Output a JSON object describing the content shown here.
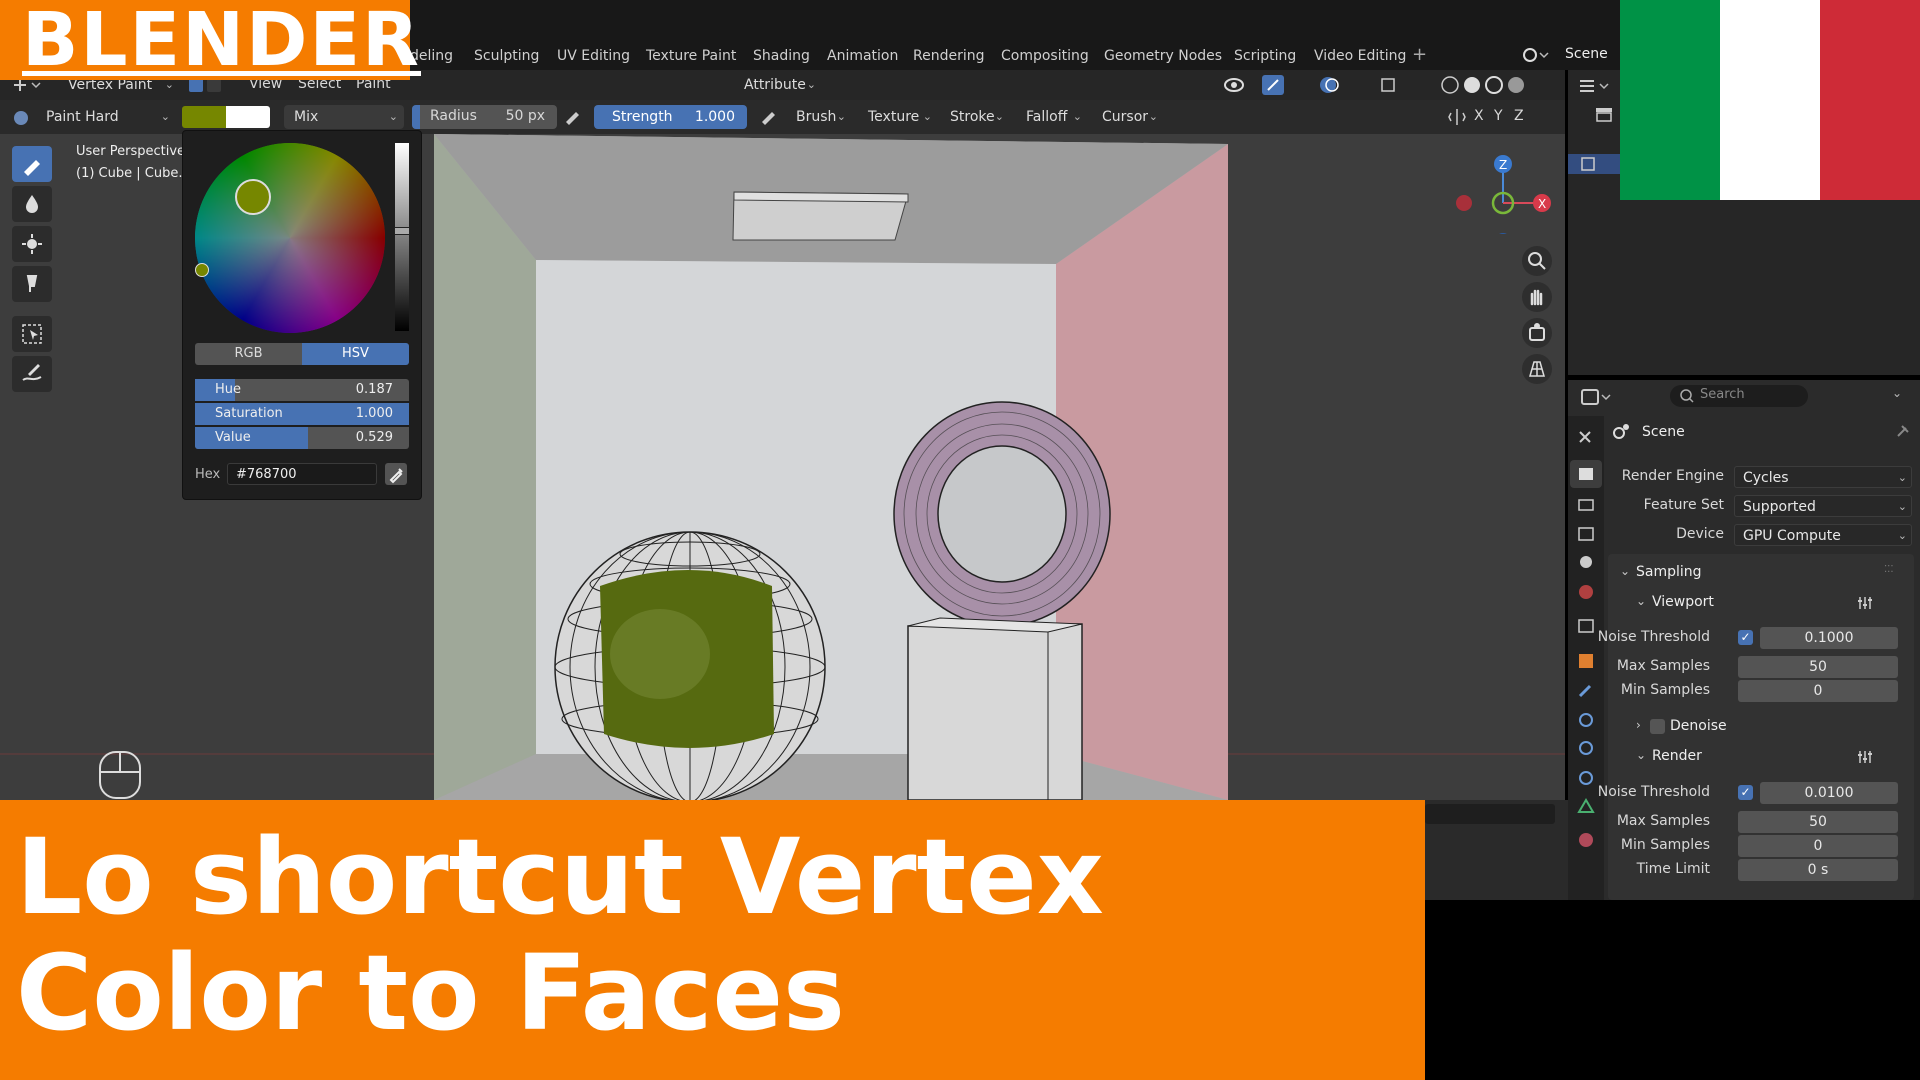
{
  "brand": {
    "text": "BLENDER"
  },
  "workspace_tabs": [
    "deling",
    "Sculpting",
    "UV Editing",
    "Texture Paint",
    "Shading",
    "Animation",
    "Rendering",
    "Compositing",
    "Geometry Nodes",
    "Scripting",
    "Video Editing"
  ],
  "scene_name": "Scene",
  "header": {
    "mode": "Vertex Paint",
    "menus": [
      "View",
      "Select",
      "Paint"
    ],
    "attribute": "Attribute"
  },
  "tool_settings": {
    "brush": "Paint Hard",
    "blend": "Mix",
    "radius_label": "Radius",
    "radius_value": "50 px",
    "strength_label": "Strength",
    "strength_value": "1.000",
    "menus": [
      "Brush",
      "Texture",
      "Stroke",
      "Falloff",
      "Cursor"
    ],
    "axes": [
      "X",
      "Y",
      "Z"
    ]
  },
  "viewport": {
    "info_line1": "User Perspective",
    "info_line2": "(1) Cube | Cube."
  },
  "color_picker": {
    "mode_rgb": "RGB",
    "mode_hsv": "HSV",
    "hue_label": "Hue",
    "hue_value": "0.187",
    "hue": 0.187,
    "sat_label": "Saturation",
    "sat_value": "1.000",
    "saturation": 1.0,
    "val_label": "Value",
    "val_value": "0.529",
    "value": 0.529,
    "hex_label": "Hex",
    "hex_value": "#768700"
  },
  "properties": {
    "search_placeholder": "Search",
    "scene_label": "Scene",
    "render_engine_label": "Render Engine",
    "render_engine": "Cycles",
    "feature_set_label": "Feature Set",
    "feature_set": "Supported",
    "device_label": "Device",
    "device": "GPU Compute",
    "sampling": "Sampling",
    "viewport_section": "Viewport",
    "noise_threshold_label": "Noise Threshold",
    "viewport_noise": "0.1000",
    "max_samples_label": "Max Samples",
    "viewport_max": "50",
    "min_samples_label": "Min Samples",
    "viewport_min": "0",
    "denoise": "Denoise",
    "render_section": "Render",
    "render_noise": "0.0100",
    "render_max": "50",
    "render_min": "0",
    "time_limit_label": "Time Limit",
    "time_limit": "0 s"
  },
  "title": {
    "line1": "Lo shortcut Vertex",
    "line2": "Color to Faces"
  },
  "colors": {
    "accent_orange": "#f57c00",
    "blender_blue": "#4772b3",
    "flag_green": "#009246",
    "flag_white": "#ffffff",
    "flag_red": "#ce2b37",
    "paint_color": "#768700"
  }
}
